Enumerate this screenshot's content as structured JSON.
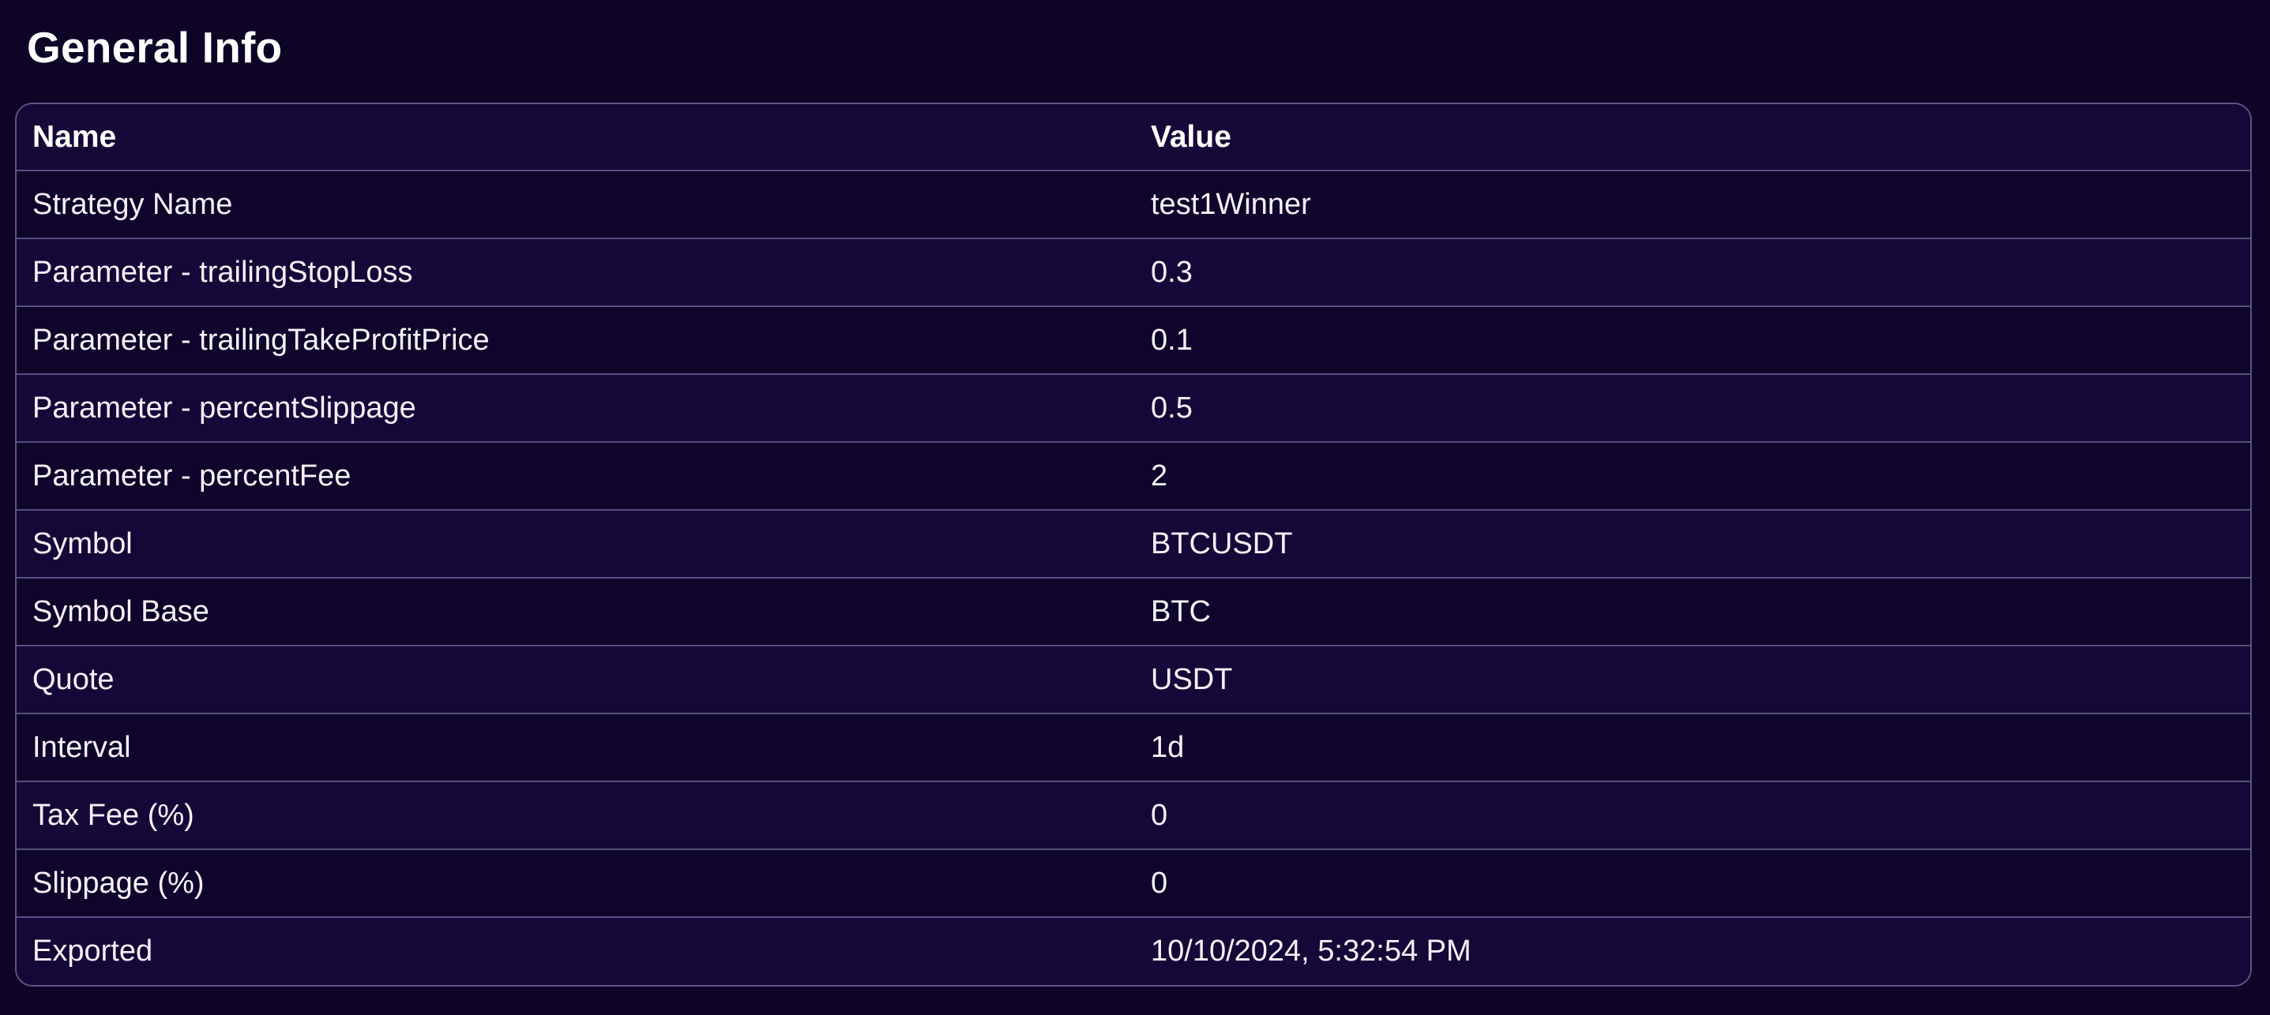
{
  "page": {
    "title": "General Info"
  },
  "table": {
    "columns": [
      "Name",
      "Value"
    ],
    "rows": [
      {
        "name": "Strategy Name",
        "value": "test1Winner"
      },
      {
        "name": "Parameter - trailingStopLoss",
        "value": "0.3"
      },
      {
        "name": "Parameter - trailingTakeProfitPrice",
        "value": "0.1"
      },
      {
        "name": "Parameter - percentSlippage",
        "value": "0.5"
      },
      {
        "name": "Parameter - percentFee",
        "value": "2"
      },
      {
        "name": "Symbol",
        "value": "BTCUSDT"
      },
      {
        "name": "Symbol Base",
        "value": "BTC"
      },
      {
        "name": "Quote",
        "value": "USDT"
      },
      {
        "name": "Interval",
        "value": "1d"
      },
      {
        "name": "Tax Fee (%)",
        "value": "0"
      },
      {
        "name": "Slippage (%)",
        "value": "0"
      },
      {
        "name": "Exported",
        "value": "10/10/2024, 5:32:54 PM"
      }
    ]
  },
  "colors": {
    "background": "#0d0426",
    "row_alt": "#150838",
    "row": "#0f042b",
    "border": "#54507d",
    "text": "#ffffff"
  }
}
